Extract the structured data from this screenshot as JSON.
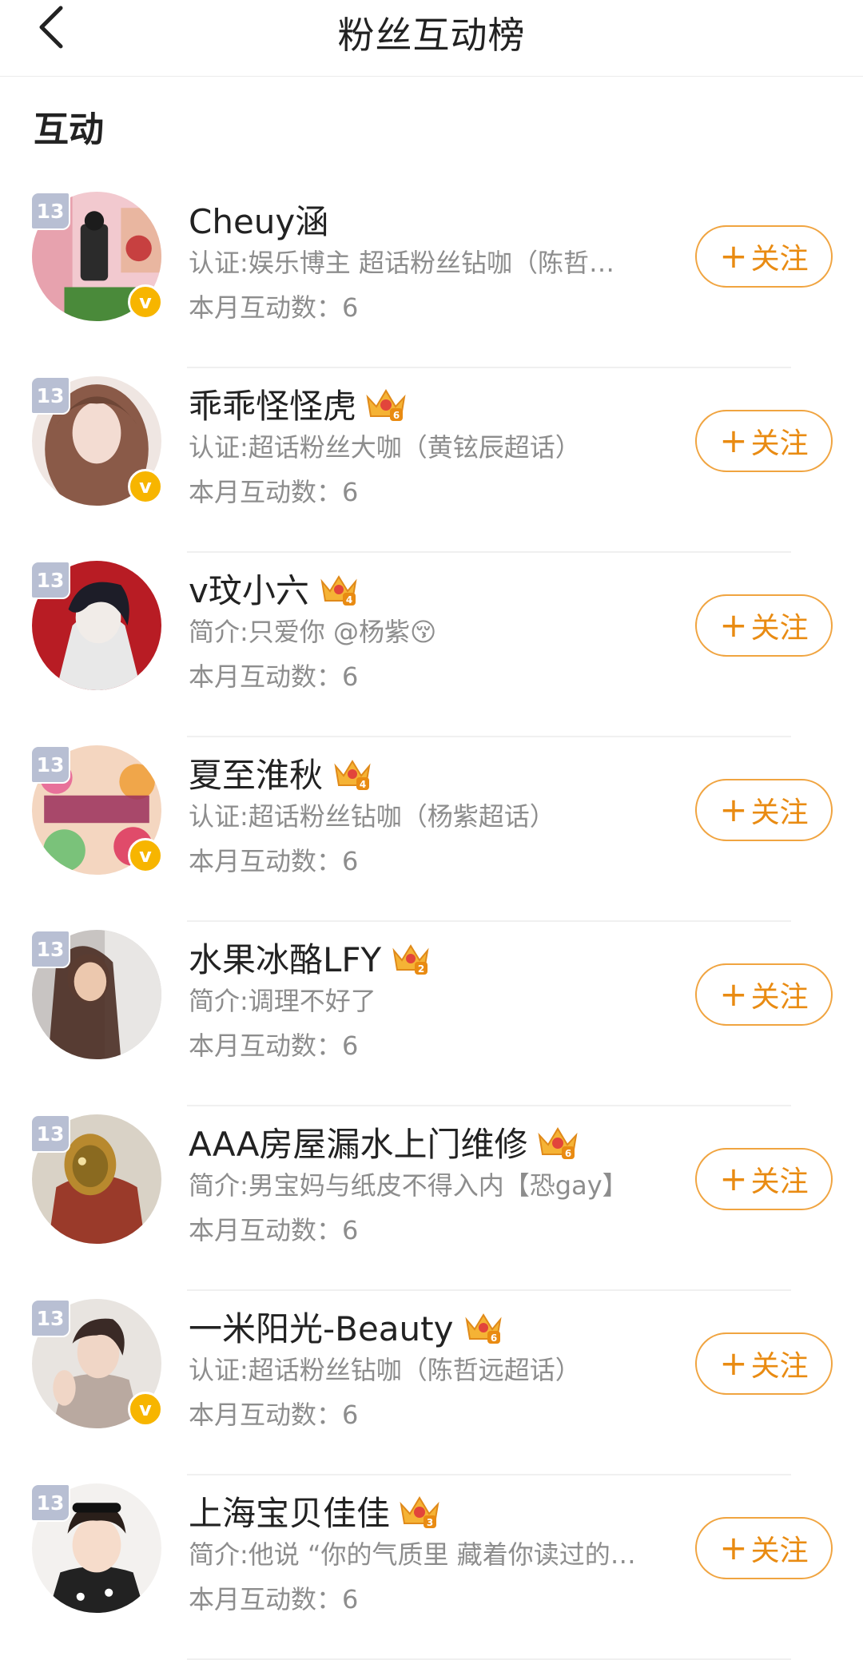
{
  "header": {
    "title": "粉丝互动榜",
    "back_icon": "chevron-left-icon"
  },
  "section": {
    "title": "互动"
  },
  "follow_label": "关注",
  "colors": {
    "accent": "#e98b12",
    "level_badge": "#b8bfd3",
    "verify": "#f7b500"
  },
  "users": [
    {
      "name": "Cheuy涵",
      "level": "13",
      "verified": true,
      "crown": null,
      "desc": "认证:娱乐博主 超话粉丝钻咖（陈哲…",
      "count": "本月互动数：6",
      "follow": "关注"
    },
    {
      "name": "乖乖怪怪虎",
      "level": "13",
      "verified": true,
      "crown": "6",
      "desc": "认证:超话粉丝大咖（黄铉辰超话）",
      "count": "本月互动数：6",
      "follow": "关注"
    },
    {
      "name": "v玟小六",
      "level": "13",
      "verified": false,
      "crown": "4",
      "desc": "简介:只爱你 @杨紫😚",
      "count": "本月互动数：6",
      "follow": "关注"
    },
    {
      "name": "夏至淮秋",
      "level": "13",
      "verified": true,
      "crown": "4",
      "desc": "认证:超话粉丝钻咖（杨紫超话）",
      "count": "本月互动数：6",
      "follow": "关注"
    },
    {
      "name": "水果冰酪LFY",
      "level": "13",
      "verified": false,
      "crown": "2",
      "desc": "简介:调理不好了",
      "count": "本月互动数：6",
      "follow": "关注"
    },
    {
      "name": "AAA房屋漏水上门维修",
      "level": "13",
      "verified": false,
      "crown": "6",
      "desc": "简介:男宝妈与纸皮不得入内【恐gay】",
      "count": "本月互动数：6",
      "follow": "关注"
    },
    {
      "name": "一米阳光-Beauty",
      "level": "13",
      "verified": true,
      "crown": "6",
      "desc": "认证:超话粉丝钻咖（陈哲远超话）",
      "count": "本月互动数：6",
      "follow": "关注"
    },
    {
      "name": "上海宝贝佳佳",
      "level": "13",
      "verified": false,
      "crown": "3",
      "desc": "简介:他说 “你的气质里 藏着你读过的…",
      "count": "本月互动数：6",
      "follow": "关注"
    }
  ]
}
